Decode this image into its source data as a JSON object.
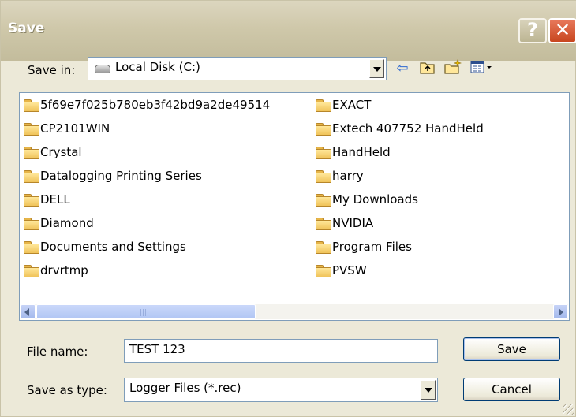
{
  "window": {
    "title": "Save"
  },
  "titlebar": {
    "help_label": "?",
    "close_label": "✕"
  },
  "save_in": {
    "label": "Save in:",
    "value": "Local Disk (C:)",
    "icon": "drive-icon"
  },
  "toolbar": {
    "icons": [
      "back-arrow-icon",
      "up-folder-icon",
      "new-folder-icon",
      "view-menu-icon"
    ]
  },
  "files": {
    "column1": [
      "5f69e7f025b780eb3f42bd9a2de49514",
      "CP2101WIN",
      "Crystal",
      "Datalogging Printing Series",
      "DELL",
      "Diamond",
      "Documents and Settings",
      "drvrtmp"
    ],
    "column2": [
      "EXACT",
      "Extech 407752 HandHeld",
      "HandHeld",
      "harry",
      "My Downloads",
      "NVIDIA",
      "Program Files",
      "PVSW"
    ]
  },
  "file_name": {
    "label": "File name:",
    "value": "TEST 123"
  },
  "save_as_type": {
    "label": "Save as type:",
    "value": "Logger Files (*.rec)"
  },
  "buttons": {
    "save": "Save",
    "cancel": "Cancel"
  },
  "colors": {
    "folder": "#f0c35a",
    "border": "#7f9db9",
    "face": "#ece9d8",
    "close": "#c8461f"
  }
}
